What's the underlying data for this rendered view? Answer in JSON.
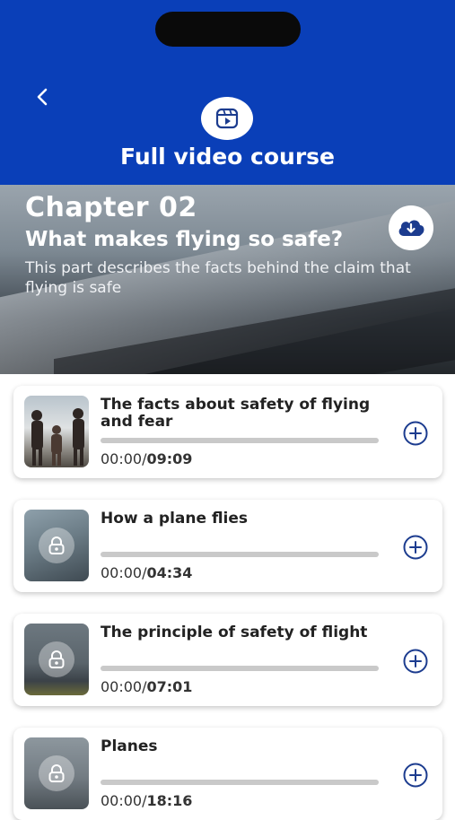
{
  "header": {
    "title": "Full video course"
  },
  "chapter": {
    "number": "Chapter 02",
    "title": "What makes flying so safe?",
    "description": "This part describes the facts behind the claim that flying is safe"
  },
  "videos": [
    {
      "title": "The facts about safety of flying and fear",
      "elapsed": "00:00",
      "duration": "09:09",
      "progress": 0,
      "locked": false
    },
    {
      "title": "How a plane flies",
      "elapsed": "00:00",
      "duration": "04:34",
      "progress": 0,
      "locked": true
    },
    {
      "title": "The principle of safety of flight",
      "elapsed": "00:00",
      "duration": "07:01",
      "progress": 0,
      "locked": true
    },
    {
      "title": "Planes",
      "elapsed": "00:00",
      "duration": "18:16",
      "progress": 0,
      "locked": true
    }
  ],
  "colors": {
    "brand_blue": "#0a3fb8",
    "accent_navy": "#1c3c8f"
  }
}
